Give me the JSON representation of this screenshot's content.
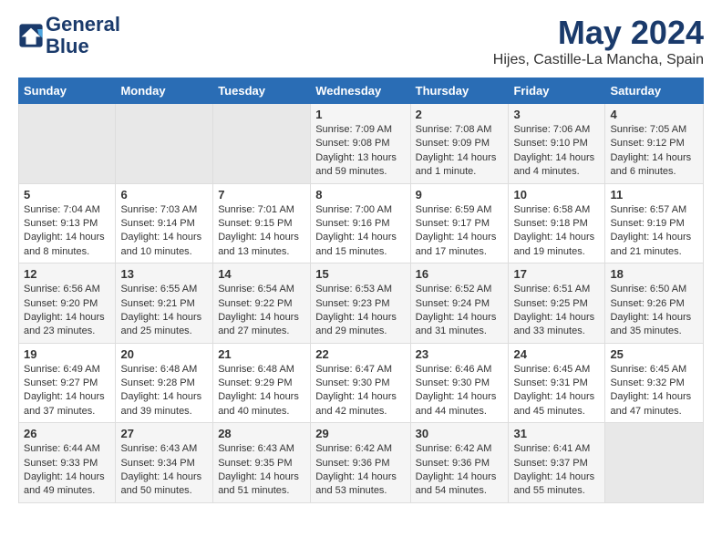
{
  "logo": {
    "line1": "General",
    "line2": "Blue"
  },
  "title": "May 2024",
  "location": "Hijes, Castille-La Mancha, Spain",
  "days_header": [
    "Sunday",
    "Monday",
    "Tuesday",
    "Wednesday",
    "Thursday",
    "Friday",
    "Saturday"
  ],
  "weeks": [
    [
      {
        "day": "",
        "empty": true
      },
      {
        "day": "",
        "empty": true
      },
      {
        "day": "",
        "empty": true
      },
      {
        "day": "1",
        "sunrise": "7:09 AM",
        "sunset": "9:08 PM",
        "daylight": "13 hours and 59 minutes."
      },
      {
        "day": "2",
        "sunrise": "7:08 AM",
        "sunset": "9:09 PM",
        "daylight": "14 hours and 1 minute."
      },
      {
        "day": "3",
        "sunrise": "7:06 AM",
        "sunset": "9:10 PM",
        "daylight": "14 hours and 4 minutes."
      },
      {
        "day": "4",
        "sunrise": "7:05 AM",
        "sunset": "9:12 PM",
        "daylight": "14 hours and 6 minutes."
      }
    ],
    [
      {
        "day": "5",
        "sunrise": "7:04 AM",
        "sunset": "9:13 PM",
        "daylight": "14 hours and 8 minutes."
      },
      {
        "day": "6",
        "sunrise": "7:03 AM",
        "sunset": "9:14 PM",
        "daylight": "14 hours and 10 minutes."
      },
      {
        "day": "7",
        "sunrise": "7:01 AM",
        "sunset": "9:15 PM",
        "daylight": "14 hours and 13 minutes."
      },
      {
        "day": "8",
        "sunrise": "7:00 AM",
        "sunset": "9:16 PM",
        "daylight": "14 hours and 15 minutes."
      },
      {
        "day": "9",
        "sunrise": "6:59 AM",
        "sunset": "9:17 PM",
        "daylight": "14 hours and 17 minutes."
      },
      {
        "day": "10",
        "sunrise": "6:58 AM",
        "sunset": "9:18 PM",
        "daylight": "14 hours and 19 minutes."
      },
      {
        "day": "11",
        "sunrise": "6:57 AM",
        "sunset": "9:19 PM",
        "daylight": "14 hours and 21 minutes."
      }
    ],
    [
      {
        "day": "12",
        "sunrise": "6:56 AM",
        "sunset": "9:20 PM",
        "daylight": "14 hours and 23 minutes."
      },
      {
        "day": "13",
        "sunrise": "6:55 AM",
        "sunset": "9:21 PM",
        "daylight": "14 hours and 25 minutes."
      },
      {
        "day": "14",
        "sunrise": "6:54 AM",
        "sunset": "9:22 PM",
        "daylight": "14 hours and 27 minutes."
      },
      {
        "day": "15",
        "sunrise": "6:53 AM",
        "sunset": "9:23 PM",
        "daylight": "14 hours and 29 minutes."
      },
      {
        "day": "16",
        "sunrise": "6:52 AM",
        "sunset": "9:24 PM",
        "daylight": "14 hours and 31 minutes."
      },
      {
        "day": "17",
        "sunrise": "6:51 AM",
        "sunset": "9:25 PM",
        "daylight": "14 hours and 33 minutes."
      },
      {
        "day": "18",
        "sunrise": "6:50 AM",
        "sunset": "9:26 PM",
        "daylight": "14 hours and 35 minutes."
      }
    ],
    [
      {
        "day": "19",
        "sunrise": "6:49 AM",
        "sunset": "9:27 PM",
        "daylight": "14 hours and 37 minutes."
      },
      {
        "day": "20",
        "sunrise": "6:48 AM",
        "sunset": "9:28 PM",
        "daylight": "14 hours and 39 minutes."
      },
      {
        "day": "21",
        "sunrise": "6:48 AM",
        "sunset": "9:29 PM",
        "daylight": "14 hours and 40 minutes."
      },
      {
        "day": "22",
        "sunrise": "6:47 AM",
        "sunset": "9:30 PM",
        "daylight": "14 hours and 42 minutes."
      },
      {
        "day": "23",
        "sunrise": "6:46 AM",
        "sunset": "9:30 PM",
        "daylight": "14 hours and 44 minutes."
      },
      {
        "day": "24",
        "sunrise": "6:45 AM",
        "sunset": "9:31 PM",
        "daylight": "14 hours and 45 minutes."
      },
      {
        "day": "25",
        "sunrise": "6:45 AM",
        "sunset": "9:32 PM",
        "daylight": "14 hours and 47 minutes."
      }
    ],
    [
      {
        "day": "26",
        "sunrise": "6:44 AM",
        "sunset": "9:33 PM",
        "daylight": "14 hours and 49 minutes."
      },
      {
        "day": "27",
        "sunrise": "6:43 AM",
        "sunset": "9:34 PM",
        "daylight": "14 hours and 50 minutes."
      },
      {
        "day": "28",
        "sunrise": "6:43 AM",
        "sunset": "9:35 PM",
        "daylight": "14 hours and 51 minutes."
      },
      {
        "day": "29",
        "sunrise": "6:42 AM",
        "sunset": "9:36 PM",
        "daylight": "14 hours and 53 minutes."
      },
      {
        "day": "30",
        "sunrise": "6:42 AM",
        "sunset": "9:36 PM",
        "daylight": "14 hours and 54 minutes."
      },
      {
        "day": "31",
        "sunrise": "6:41 AM",
        "sunset": "9:37 PM",
        "daylight": "14 hours and 55 minutes."
      },
      {
        "day": "",
        "empty": true
      }
    ]
  ]
}
